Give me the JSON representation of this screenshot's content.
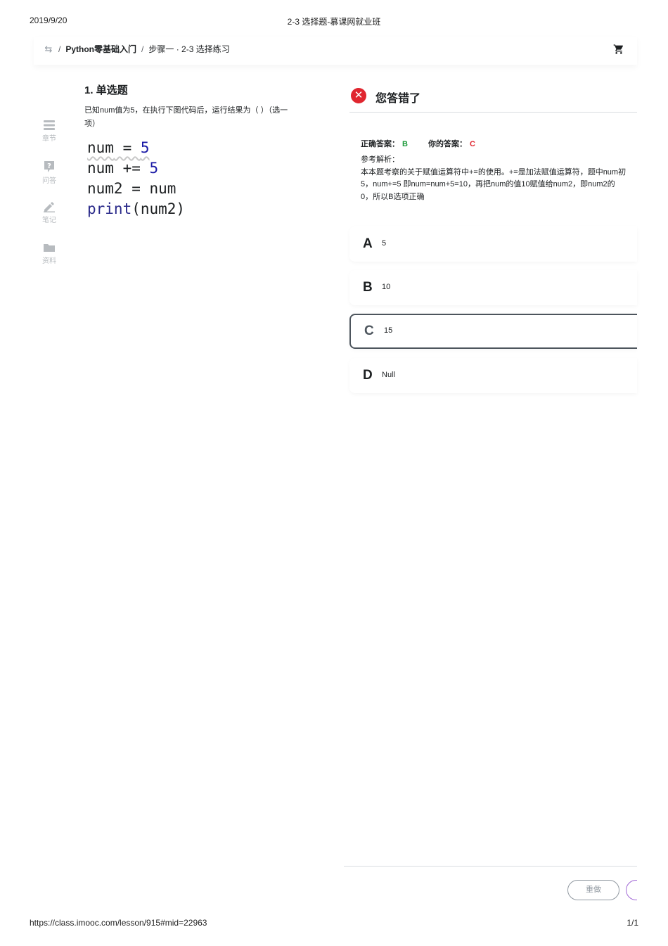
{
  "print": {
    "date": "2019/9/20",
    "doc_title": "2-3 选择题-慕课网就业班",
    "url": "https://class.imooc.com/lesson/915#mid=22963",
    "page": "1/1"
  },
  "breadcrumb": {
    "sep": "/",
    "course": "Python零基础入门",
    "lesson": "步骤一 · 2-3 选择练习"
  },
  "sidenav": {
    "chapters": "章节",
    "qa": "问答",
    "notes": "笔记",
    "materials": "资料"
  },
  "question": {
    "title": "1. 单选题",
    "text": "已知num值为5，在执行下图代码后，运行结果为（ ）（选一项）",
    "code": {
      "l1_var": "num",
      "l1_op": " = ",
      "l1_val": "5",
      "l2_var": "num",
      "l2_op": " += ",
      "l2_val": "5",
      "l3": "num2 = num",
      "l4_fn": "print",
      "l4_args": "(num2)"
    }
  },
  "result": {
    "icon": "✕",
    "title": "您答错了",
    "correct_label": "正确答案：",
    "correct_value": "B",
    "yours_label": "你的答案：",
    "yours_value": "C",
    "analysis_label": "参考解析：",
    "analysis_l1": "本本题考察的关于赋值运算符中+=的使用。+=是加法赋值运算符，题中num初",
    "analysis_l2": "5，num+=5 即num=num+5=10，再把num的值10赋值给num2，即num2的",
    "analysis_l3": "0，所以B选项正确"
  },
  "options": [
    {
      "letter": "A",
      "value": "5"
    },
    {
      "letter": "B",
      "value": "10"
    },
    {
      "letter": "C",
      "value": "15"
    },
    {
      "letter": "D",
      "value": "Null"
    }
  ],
  "actions": {
    "redo": "重做"
  },
  "colors": {
    "wrong": "#e0262f",
    "correct": "#1c9a3a",
    "code_number": "#1a1aa6",
    "next_border": "#a26ad6"
  }
}
